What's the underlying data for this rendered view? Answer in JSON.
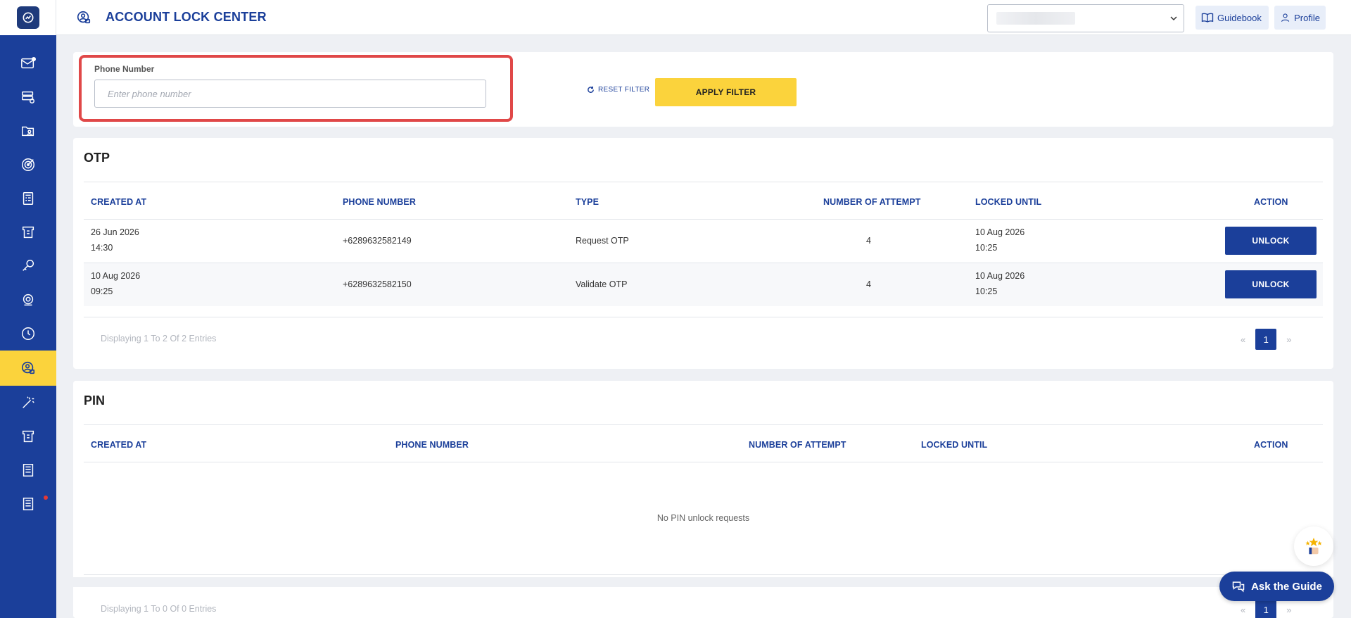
{
  "header": {
    "title": "ACCOUNT LOCK CENTER",
    "guidebook_label": "Guidebook",
    "profile_label": "Profile"
  },
  "sidebar": {
    "items": [
      {
        "icon": "mail-notification-icon",
        "active": false
      },
      {
        "icon": "server-settings-icon",
        "active": false
      },
      {
        "icon": "folder-user-icon",
        "active": false
      },
      {
        "icon": "target-icon",
        "active": false
      },
      {
        "icon": "calculator-icon",
        "active": false
      },
      {
        "icon": "ticket-icon",
        "active": false
      },
      {
        "icon": "key-icon",
        "active": false
      },
      {
        "icon": "atm-settings-icon",
        "active": false
      },
      {
        "icon": "history-icon",
        "active": false
      },
      {
        "icon": "account-lock-icon",
        "active": true
      },
      {
        "icon": "magic-wand-icon",
        "active": false
      },
      {
        "icon": "ticket-icon",
        "active": false
      },
      {
        "icon": "report-icon",
        "active": false
      },
      {
        "icon": "report-icon",
        "active": false
      }
    ]
  },
  "filter": {
    "phone_label": "Phone Number",
    "phone_placeholder": "Enter phone number",
    "reset_label": "RESET FILTER",
    "apply_label": "APPLY FILTER"
  },
  "otp": {
    "title": "OTP",
    "columns": [
      "CREATED AT",
      "PHONE NUMBER",
      "TYPE",
      "NUMBER OF ATTEMPT",
      "LOCKED UNTIL",
      "ACTION"
    ],
    "rows": [
      {
        "created_date": "26 Jun 2026",
        "created_time": "14:30",
        "phone": "+6289632582149",
        "type": "Request OTP",
        "attempts": "4",
        "locked_date": "10 Aug 2026",
        "locked_time": "10:25",
        "action": "UNLOCK"
      },
      {
        "created_date": "10 Aug 2026",
        "created_time": "09:25",
        "phone": "+6289632582150",
        "type": "Validate OTP",
        "attempts": "4",
        "locked_date": "10 Aug 2026",
        "locked_time": "10:25",
        "action": "UNLOCK"
      }
    ],
    "entries_text": "Displaying 1 To 2 Of 2 Entries",
    "pager": {
      "prev": "«",
      "page": "1",
      "next": "»"
    }
  },
  "pin": {
    "title": "PIN",
    "columns": [
      "CREATED AT",
      "PHONE NUMBER",
      "NUMBER OF ATTEMPT",
      "LOCKED UNTIL",
      "ACTION"
    ],
    "empty_text": "No PIN unlock requests",
    "entries_text": "Displaying 1 To 0 Of 0 Entries",
    "pager": {
      "prev": "«",
      "page": "1",
      "next": "»"
    }
  },
  "floating": {
    "ask_guide_label": "Ask the Guide"
  },
  "colors": {
    "primary": "#1b3f9a",
    "accent": "#fbd33c",
    "highlight": "#e04848"
  }
}
